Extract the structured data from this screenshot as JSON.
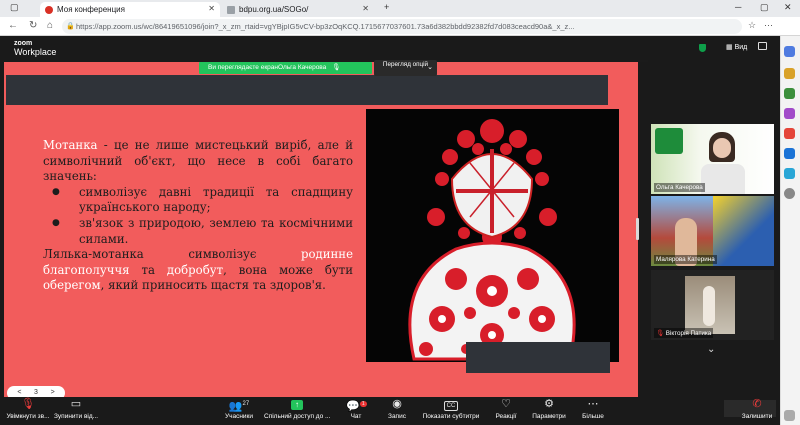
{
  "browser": {
    "tabs": [
      {
        "label": "Моя конференция",
        "active": true
      },
      {
        "label": "bdpu.org.ua/SOGo/",
        "active": false
      }
    ],
    "new_tab": "+",
    "url": "https://app.zoom.us/wc/86419651096/join?_x_zm_rtaid=vgYBjpIG5vCV-bp3zOqKCQ.1715677037601.73a6d382bbdd92382fd7d083ceacd90a&_x_z..."
  },
  "zoom": {
    "logo_top": "zoom",
    "logo_bottom": "Workplace",
    "view_label": "Вид",
    "share_banner": "Ви переглядаєте екранОльга Качерова",
    "view_options": "Перегляд опцій"
  },
  "slide": {
    "p1_bold": "Мотанка",
    "p1_rest": " - це не лише мистецький виріб, але й символічний об'єкт, що несе в собі багато значень:",
    "bullets": [
      "символізує давні традиції та спадщину українського народу;",
      "зв'язок з природою, землею та космічними силами."
    ],
    "p2_a": "Лялька-мотанка символізує ",
    "p2_w1": "родинне благополуччя",
    "p2_b": " та ",
    "p2_w2": "добробут",
    "p2_c": ", вона може бути ",
    "p2_w3": "оберегом",
    "p2_d": ", який приносить щастя та здоров'я.",
    "pager": [
      "<",
      "3",
      ">"
    ]
  },
  "participants": [
    {
      "name": "Ольга Качерова"
    },
    {
      "name": "Малярова Катерина"
    },
    {
      "name": "Вікторія Патика"
    }
  ],
  "toolbar": {
    "mute": "Увімкнути зв...",
    "video": "Зупинити від...",
    "participants": "Учасники",
    "participants_count": "27",
    "share": "Спільний доступ до ...",
    "chat": "Чат",
    "chat_badge": "1",
    "record": "Запис",
    "captions": "Показати субтитри",
    "captions_icon": "CC",
    "reactions": "Реакції",
    "settings": "Параметри",
    "more": "Більше",
    "leave": "Залишити"
  },
  "colors": {
    "slide_bg": "#f25c5c",
    "share_green": "#23c45c",
    "zoom_dark": "#1a1a1a"
  }
}
